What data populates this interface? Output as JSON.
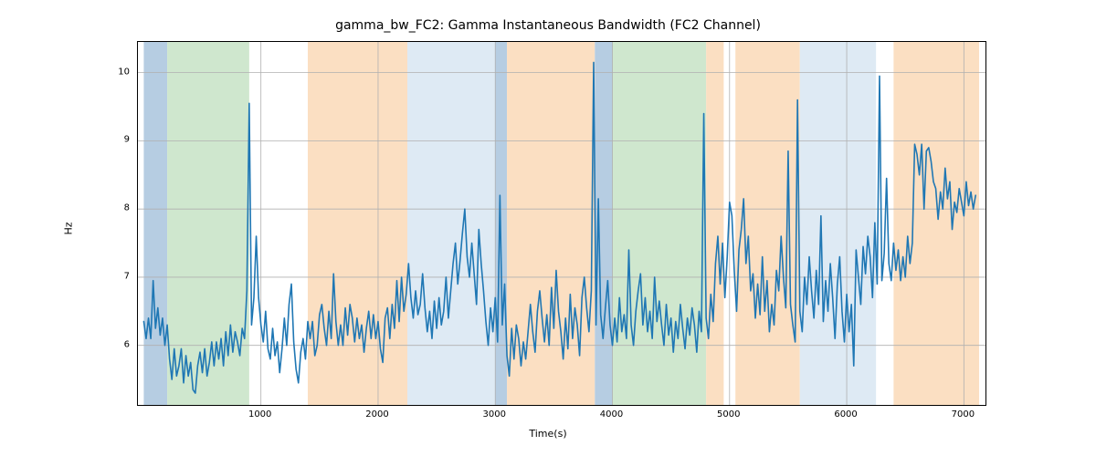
{
  "chart_data": {
    "type": "line",
    "title": "gamma_bw_FC2: Gamma Instantaneous Bandwidth (FC2 Channel)",
    "xlabel": "Time(s)",
    "ylabel": "Hz",
    "xlim": [
      -50,
      7200
    ],
    "ylim": [
      5.1,
      10.45
    ],
    "xticks": [
      1000,
      2000,
      3000,
      4000,
      5000,
      6000,
      7000
    ],
    "yticks": [
      6,
      7,
      8,
      9,
      10
    ],
    "line_color": "#1f77b4",
    "bands": [
      {
        "x0": 0,
        "x1": 200,
        "color": "#b6cde2"
      },
      {
        "x0": 200,
        "x1": 900,
        "color": "#cfe7ce"
      },
      {
        "x0": 1400,
        "x1": 2250,
        "color": "#fbdfc2"
      },
      {
        "x0": 2250,
        "x1": 3000,
        "color": "#deeaf4"
      },
      {
        "x0": 3000,
        "x1": 3100,
        "color": "#b6cde2"
      },
      {
        "x0": 3100,
        "x1": 3850,
        "color": "#fbdfc2"
      },
      {
        "x0": 3850,
        "x1": 4000,
        "color": "#b6cde2"
      },
      {
        "x0": 4000,
        "x1": 4800,
        "color": "#cfe7ce"
      },
      {
        "x0": 4800,
        "x1": 4950,
        "color": "#fbdfc2"
      },
      {
        "x0": 5050,
        "x1": 5600,
        "color": "#fbdfc2"
      },
      {
        "x0": 5600,
        "x1": 6250,
        "color": "#deeaf4"
      },
      {
        "x0": 6400,
        "x1": 7130,
        "color": "#fbdfc2"
      }
    ],
    "series": [
      {
        "name": "gamma_bw_FC2",
        "x_step": 20,
        "x_start": 0,
        "values": [
          6.35,
          6.1,
          6.4,
          6.1,
          6.95,
          6.25,
          6.55,
          6.15,
          6.4,
          6.0,
          6.3,
          5.8,
          5.5,
          5.95,
          5.55,
          5.7,
          5.95,
          5.45,
          5.85,
          5.55,
          5.75,
          5.35,
          5.3,
          5.7,
          5.9,
          5.6,
          5.95,
          5.55,
          5.75,
          6.05,
          5.7,
          6.05,
          5.8,
          6.1,
          5.7,
          6.2,
          5.85,
          6.3,
          5.9,
          6.2,
          6.05,
          5.85,
          6.25,
          6.1,
          6.8,
          9.55,
          6.3,
          6.7,
          7.6,
          6.7,
          6.3,
          6.05,
          6.5,
          5.95,
          5.8,
          6.25,
          5.85,
          6.05,
          5.6,
          5.95,
          6.4,
          6.0,
          6.6,
          6.9,
          6.05,
          5.65,
          5.45,
          5.9,
          6.1,
          5.8,
          6.35,
          6.1,
          6.35,
          5.85,
          6.0,
          6.45,
          6.6,
          6.25,
          6.0,
          6.5,
          6.1,
          7.05,
          6.35,
          6.0,
          6.3,
          6.0,
          6.55,
          6.15,
          6.6,
          6.4,
          6.05,
          6.4,
          6.1,
          6.3,
          5.9,
          6.25,
          6.5,
          6.1,
          6.45,
          6.1,
          6.35,
          5.95,
          5.75,
          6.4,
          6.55,
          6.1,
          6.6,
          6.25,
          6.95,
          6.35,
          7.0,
          6.5,
          6.75,
          7.2,
          6.7,
          6.4,
          6.8,
          6.45,
          6.6,
          7.05,
          6.55,
          6.2,
          6.5,
          6.1,
          6.65,
          6.25,
          6.7,
          6.3,
          6.5,
          7.0,
          6.4,
          6.8,
          7.2,
          7.5,
          6.9,
          7.25,
          7.65,
          8.0,
          7.3,
          7.0,
          7.5,
          7.05,
          6.6,
          7.7,
          7.2,
          6.8,
          6.35,
          6.0,
          6.55,
          6.2,
          6.7,
          6.05,
          8.2,
          6.3,
          6.9,
          5.85,
          5.55,
          6.25,
          5.8,
          6.3,
          6.1,
          5.7,
          6.05,
          5.8,
          6.2,
          6.6,
          6.2,
          5.9,
          6.5,
          6.8,
          6.4,
          6.05,
          6.45,
          6.0,
          6.85,
          6.25,
          7.1,
          6.5,
          6.2,
          5.8,
          6.4,
          5.95,
          6.75,
          6.1,
          6.55,
          6.3,
          5.85,
          6.7,
          7.0,
          6.55,
          6.2,
          6.8,
          10.15,
          6.3,
          8.15,
          6.45,
          6.1,
          6.55,
          6.95,
          6.3,
          6.0,
          6.4,
          6.05,
          6.7,
          6.2,
          6.45,
          6.1,
          7.4,
          6.3,
          6.0,
          6.5,
          6.8,
          7.05,
          6.3,
          6.7,
          6.2,
          6.5,
          6.1,
          7.0,
          6.35,
          6.65,
          6.3,
          6.0,
          6.6,
          6.15,
          6.4,
          5.9,
          6.35,
          6.1,
          6.6,
          6.25,
          5.95,
          6.4,
          6.15,
          6.55,
          6.3,
          5.9,
          6.5,
          6.2,
          9.4,
          6.4,
          6.1,
          6.75,
          6.35,
          7.2,
          7.6,
          6.9,
          7.5,
          6.7,
          7.3,
          8.1,
          7.9,
          7.1,
          6.5,
          7.4,
          7.7,
          8.15,
          7.2,
          7.6,
          6.8,
          7.05,
          6.4,
          6.9,
          6.45,
          7.3,
          6.5,
          6.95,
          6.2,
          6.6,
          6.3,
          7.1,
          6.8,
          7.6,
          7.0,
          6.55,
          8.85,
          6.6,
          6.3,
          6.05,
          9.6,
          6.5,
          6.2,
          7.0,
          6.6,
          7.3,
          6.8,
          6.4,
          7.1,
          6.6,
          7.9,
          6.35,
          6.95,
          6.5,
          7.2,
          6.7,
          6.1,
          6.9,
          7.3,
          6.5,
          6.05,
          6.75,
          6.2,
          6.6,
          5.7,
          7.4,
          7.0,
          6.6,
          7.45,
          7.05,
          7.6,
          7.3,
          6.7,
          7.8,
          6.9,
          9.95,
          6.95,
          7.35,
          8.45,
          7.2,
          6.95,
          7.5,
          7.1,
          7.4,
          6.95,
          7.3,
          7.0,
          7.6,
          7.2,
          7.5,
          8.95,
          8.8,
          8.5,
          8.95,
          8.0,
          8.85,
          8.9,
          8.7,
          8.4,
          8.3,
          7.85,
          8.25,
          8.0,
          8.6,
          8.15,
          8.4,
          7.7,
          8.1,
          7.95,
          8.3,
          8.1,
          7.9,
          8.4,
          8.05,
          8.25,
          8.0,
          8.2
        ]
      }
    ]
  }
}
